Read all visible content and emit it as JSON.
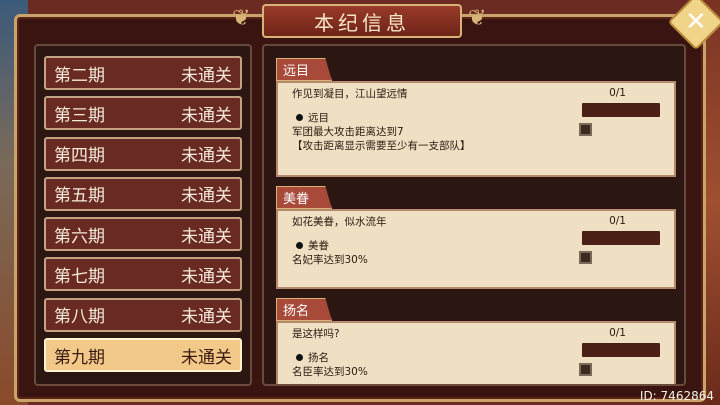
{
  "window": {
    "title": "本纪信息",
    "close_icon": "close-x-icon"
  },
  "periods": [
    {
      "name": "第二期",
      "status": "未通关",
      "active": false
    },
    {
      "name": "第三期",
      "status": "未通关",
      "active": false
    },
    {
      "name": "第四期",
      "status": "未通关",
      "active": false
    },
    {
      "name": "第五期",
      "status": "未通关",
      "active": false
    },
    {
      "name": "第六期",
      "status": "未通关",
      "active": false
    },
    {
      "name": "第七期",
      "status": "未通关",
      "active": false
    },
    {
      "name": "第八期",
      "status": "未通关",
      "active": false
    },
    {
      "name": "第九期",
      "status": "未通关",
      "active": true
    }
  ],
  "sections": [
    {
      "tab": "远目",
      "quote": "作见到凝目，江山望远情",
      "progress": "0/1",
      "goal_title": "远目",
      "goal_desc": "军团最大攻击距离达到7",
      "goal_note": "【攻击距离显示需要至少有一支部队】"
    },
    {
      "tab": "美眷",
      "quote": "如花美眷，似水流年",
      "progress": "0/1",
      "goal_title": "美眷",
      "goal_desc": "名妃率达到30%"
    },
    {
      "tab": "扬名",
      "quote": "是这样吗?",
      "progress": "0/1",
      "goal_title": "扬名",
      "goal_desc": "名臣率达到30%"
    }
  ],
  "footer": {
    "id_text": "ID: 7462864"
  }
}
